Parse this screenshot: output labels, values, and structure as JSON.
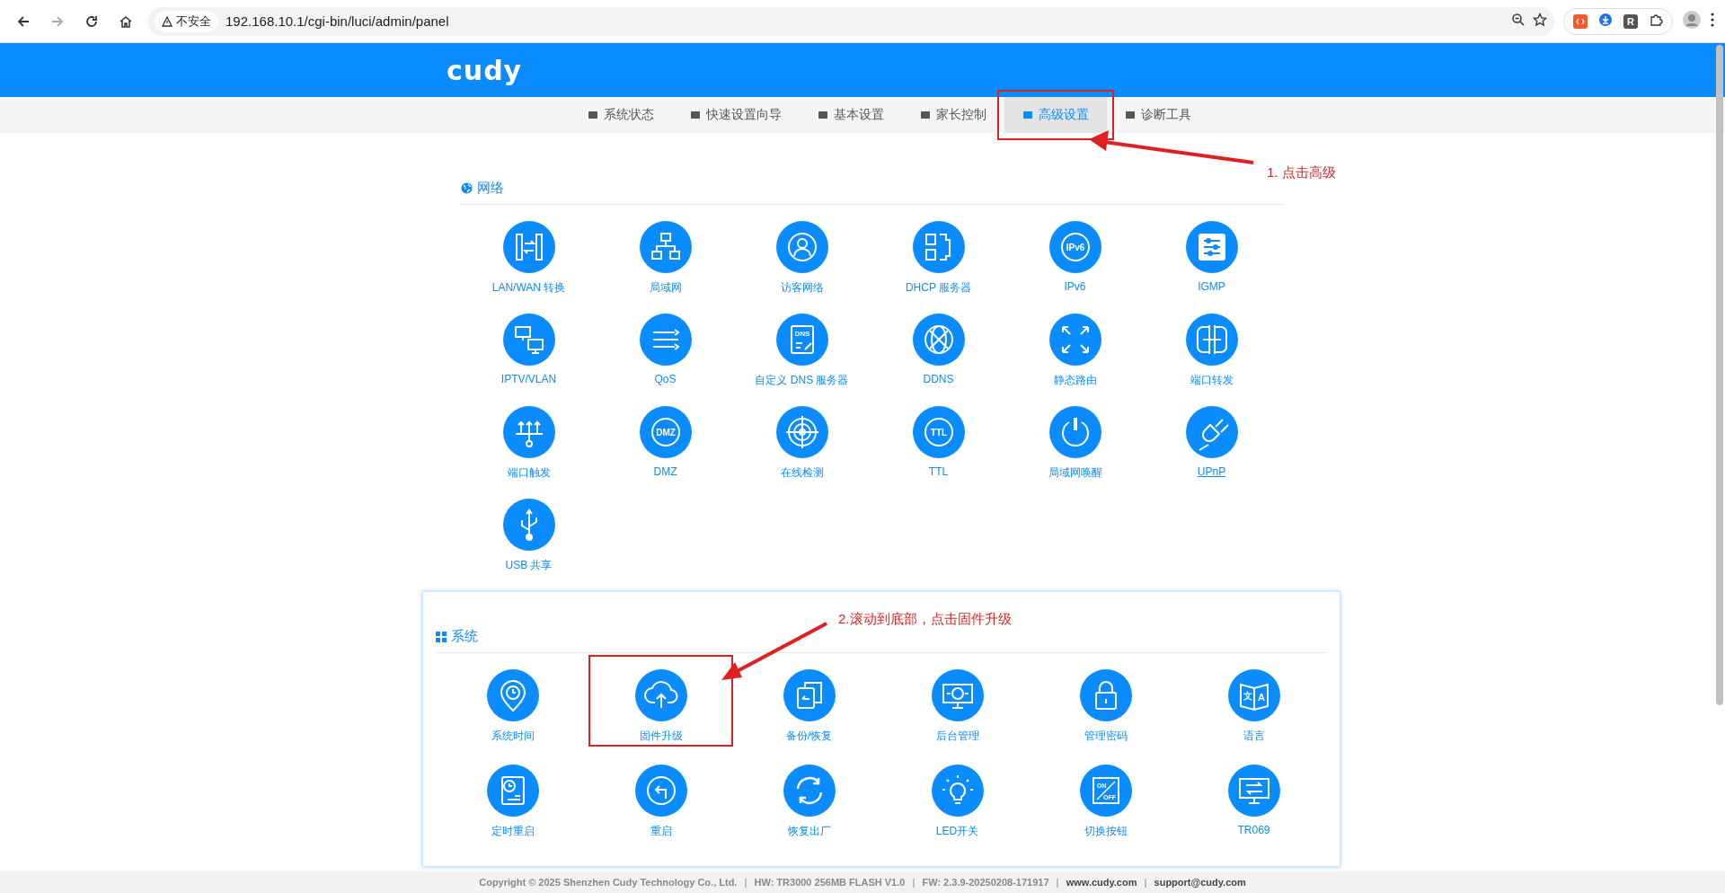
{
  "browser": {
    "url_warning": "不安全",
    "url": "192.168.10.1/cgi-bin/luci/admin/panel",
    "extensions": [
      {
        "label": "R"
      }
    ]
  },
  "header": {
    "logo": "cudy"
  },
  "nav": [
    {
      "label": "系统状态",
      "selected": false,
      "annotated": false
    },
    {
      "label": "快速设置向导",
      "selected": false,
      "annotated": false
    },
    {
      "label": "基本设置",
      "selected": false,
      "annotated": false
    },
    {
      "label": "家长控制",
      "selected": false,
      "annotated": false
    },
    {
      "label": "高级设置",
      "selected": true,
      "annotated": true
    },
    {
      "label": "诊断工具",
      "selected": false,
      "annotated": false
    }
  ],
  "network": {
    "title": "网络",
    "items": [
      {
        "label": "LAN/WAN 转换",
        "hovered": false
      },
      {
        "label": "局域网",
        "hovered": false
      },
      {
        "label": "访客网络",
        "hovered": false
      },
      {
        "label": "DHCP 服务器",
        "hovered": false
      },
      {
        "label": "IPv6",
        "hovered": false,
        "icon_text": [
          "IPv6"
        ]
      },
      {
        "label": "IGMP",
        "hovered": false
      },
      {
        "label": "IPTV/VLAN",
        "hovered": false
      },
      {
        "label": "QoS",
        "hovered": false
      },
      {
        "label": "自定义 DNS 服务器",
        "hovered": false,
        "icon_text": [
          "DNS"
        ]
      },
      {
        "label": "DDNS",
        "hovered": false
      },
      {
        "label": "静态路由",
        "hovered": false
      },
      {
        "label": "端口转发",
        "hovered": false
      },
      {
        "label": "端口触发",
        "hovered": false
      },
      {
        "label": "DMZ",
        "hovered": false,
        "icon_text": [
          "DMZ"
        ]
      },
      {
        "label": "在线检测",
        "hovered": false
      },
      {
        "label": "TTL",
        "hovered": false,
        "icon_text": [
          "TTL"
        ]
      },
      {
        "label": "局域网唤醒",
        "hovered": false
      },
      {
        "label": "UPnP",
        "hovered": true
      },
      {
        "label": "USB 共享",
        "hovered": false
      }
    ]
  },
  "system": {
    "title": "系统",
    "items": [
      {
        "label": "系统时间",
        "annotated": false
      },
      {
        "label": "固件升级",
        "annotated": true
      },
      {
        "label": "备份/恢复",
        "annotated": false
      },
      {
        "label": "后台管理",
        "annotated": false
      },
      {
        "label": "管理密码",
        "annotated": false
      },
      {
        "label": "语言",
        "annotated": false,
        "icon_text": [
          "文",
          "A"
        ]
      },
      {
        "label": "定时重启",
        "annotated": false
      },
      {
        "label": "重启",
        "annotated": false
      },
      {
        "label": "恢复出厂",
        "annotated": false
      },
      {
        "label": "LED开关",
        "annotated": false
      },
      {
        "label": "切换按钮",
        "annotated": false,
        "icon_text": [
          "ON",
          "OFF"
        ]
      },
      {
        "label": "TR069",
        "annotated": false
      }
    ]
  },
  "annotations": [
    "1. 点击高级",
    "2.滚动到底部，点击固件升级"
  ],
  "footer": [
    {
      "text": "Copyright © 2025 Shenzhen Cudy Technology Co., Ltd.",
      "kind": "text"
    },
    {
      "text": "|",
      "kind": "sep"
    },
    {
      "text": "HW: TR3000 256MB FLASH V1.0",
      "kind": "text"
    },
    {
      "text": "|",
      "kind": "sep"
    },
    {
      "text": "FW: 2.3.9-20250208-171917",
      "kind": "text"
    },
    {
      "text": "|",
      "kind": "sep"
    },
    {
      "text": "www.cudy.com",
      "kind": "link"
    },
    {
      "text": "|",
      "kind": "sep"
    },
    {
      "text": "support@cudy.com",
      "kind": "link"
    }
  ]
}
